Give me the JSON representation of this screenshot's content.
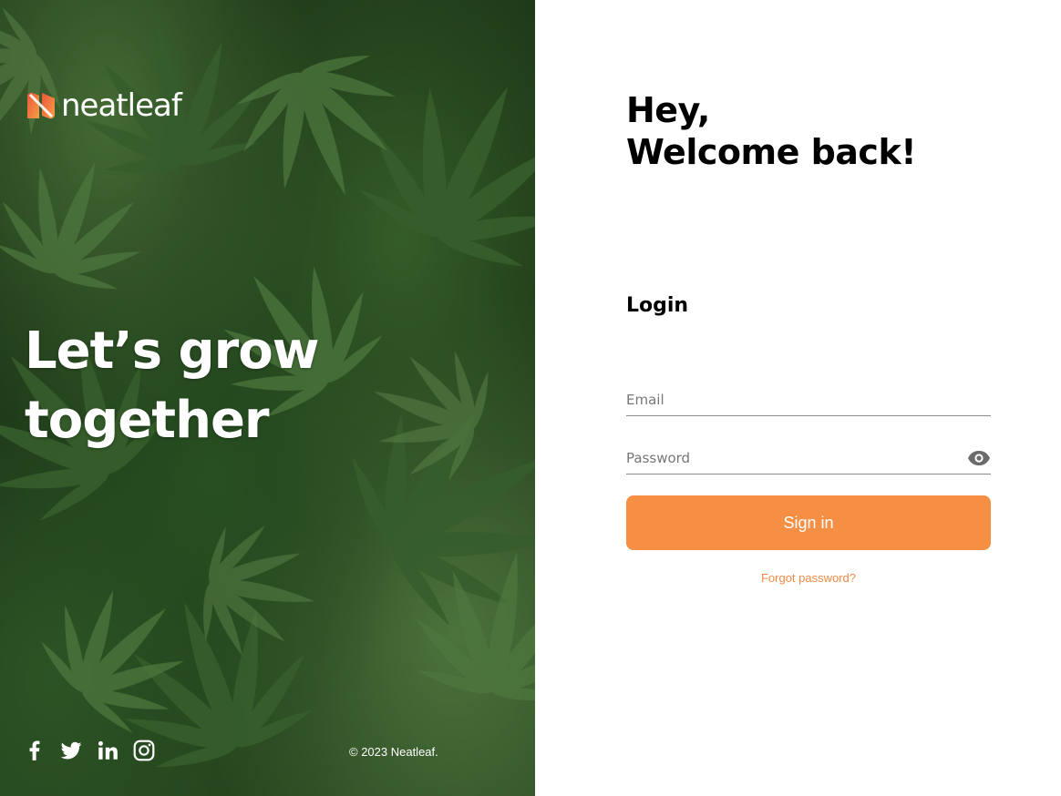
{
  "brand": {
    "name": "neatleaf",
    "accent_color": "#f58f44"
  },
  "hero": {
    "tagline_line1": "Let’s grow",
    "tagline_line2": "together"
  },
  "social": {
    "icons": [
      "facebook-icon",
      "twitter-icon",
      "linkedin-icon",
      "instagram-icon"
    ]
  },
  "footer": {
    "copyright": "© 2023 Neatleaf."
  },
  "login": {
    "greeting_line1": "Hey,",
    "greeting_line2": "Welcome back!",
    "heading": "Login",
    "email_placeholder": "Email",
    "password_placeholder": "Password",
    "signin_label": "Sign in",
    "forgot_label": "Forgot password?"
  }
}
